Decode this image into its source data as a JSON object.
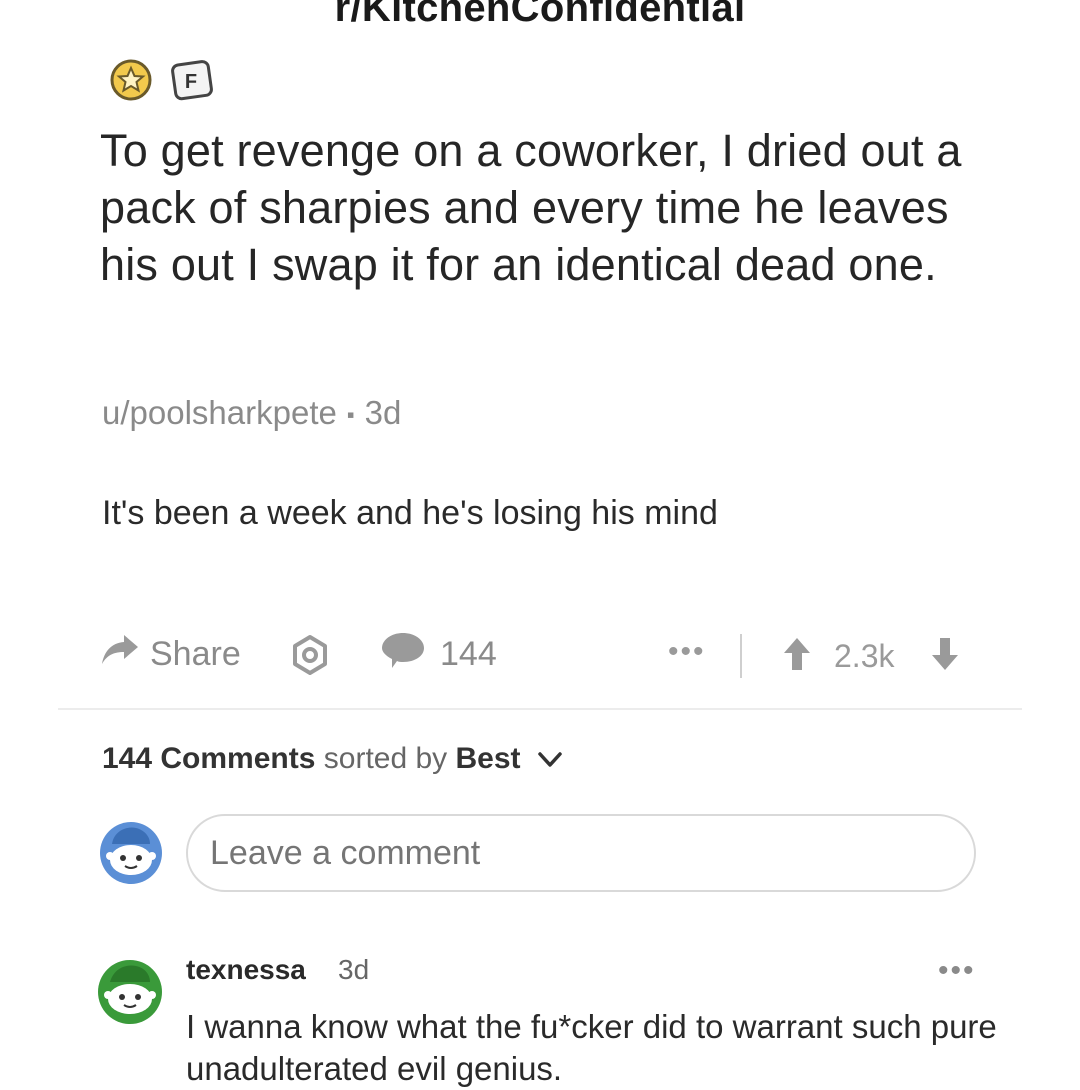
{
  "subreddit": "r/KitchenConfidential",
  "badges": {
    "award_icon": "award-badge-icon",
    "flair_letter": "F"
  },
  "post": {
    "title": "To get revenge on a coworker, I dried out a pack of sharpies and every time he leaves his out I swap it for an identical dead one.",
    "author": "u/poolsharkpete",
    "age": "3d",
    "body": "It's been a week and he's losing his mind"
  },
  "actions": {
    "share_label": "Share",
    "comment_count": "144",
    "score": "2.3k"
  },
  "sort": {
    "count_label": "144 Comments",
    "sorted_by_label": "sorted by",
    "selected": "Best"
  },
  "comment_box": {
    "placeholder": "Leave a comment"
  },
  "comments": [
    {
      "user": "texnessa",
      "age": "3d",
      "text": "I wanna know what the fu*cker did to warrant such pure unadulterated evil genius."
    }
  ],
  "colors": {
    "avatar_blue": "#5b8fd6",
    "avatar_green": "#3a9a3a",
    "award_gold": "#e8b93a",
    "muted_gray": "#8a8a8a"
  }
}
